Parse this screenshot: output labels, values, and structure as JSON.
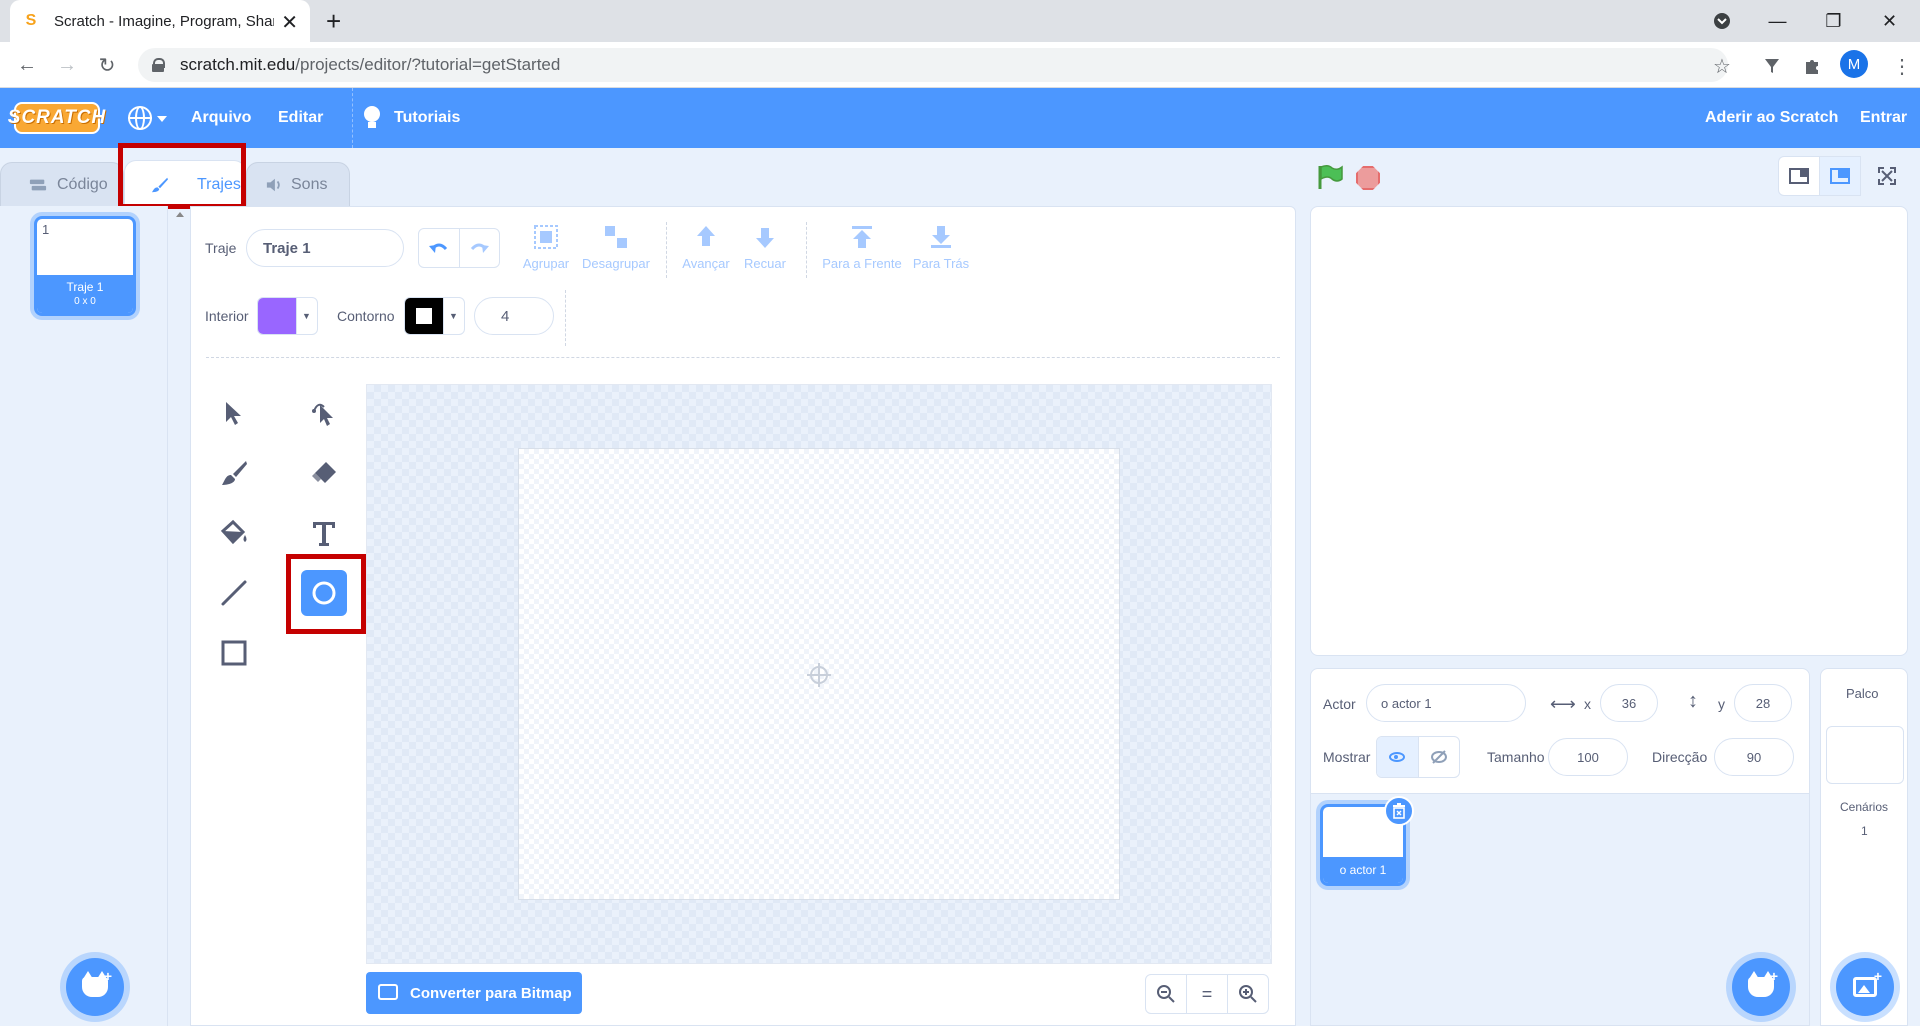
{
  "browser": {
    "tab_title": "Scratch - Imagine, Program, Share",
    "favicon": "S",
    "url_host": "scratch.mit.edu",
    "url_path": "/projects/editor/?tutorial=getStarted",
    "profile_initial": "M"
  },
  "menu": {
    "logo": "SCRATCH",
    "file": "Arquivo",
    "edit": "Editar",
    "tutorials": "Tutoriais",
    "join": "Aderir ao Scratch",
    "signin": "Entrar"
  },
  "tabs": {
    "code": "Código",
    "costumes": "Trajes",
    "sounds": "Sons"
  },
  "costumes": {
    "items": [
      {
        "number": "1",
        "name": "Traje 1",
        "size": "0 x 0"
      }
    ]
  },
  "paint": {
    "costume_label": "Traje",
    "costume_name": "Traje 1",
    "group": "Agrupar",
    "ungroup": "Desagrupar",
    "forward": "Avançar",
    "backward": "Recuar",
    "front": "Para a Frente",
    "back": "Para Trás",
    "fill_label": "Interior",
    "fill_color": "#9966FF",
    "outline_label": "Contorno",
    "outline_color": "#000000",
    "outline_width": "4",
    "convert_bitmap": "Converter para Bitmap",
    "zoom_reset": "=",
    "selected_tool": "circle-icon"
  },
  "sprite": {
    "actor_label": "Actor",
    "name": "o actor 1",
    "x_label": "x",
    "x": "36",
    "y_label": "y",
    "y": "28",
    "show_label": "Mostrar",
    "size_label": "Tamanho",
    "size": "100",
    "direction_label": "Direcção",
    "direction": "90",
    "list": [
      {
        "name": "o actor 1"
      }
    ]
  },
  "stage": {
    "label": "Palco",
    "backdrops_label": "Cenários",
    "backdrops_count": "1"
  },
  "colors": {
    "accent": "#4c97ff",
    "highlight_box": "#c50000"
  }
}
